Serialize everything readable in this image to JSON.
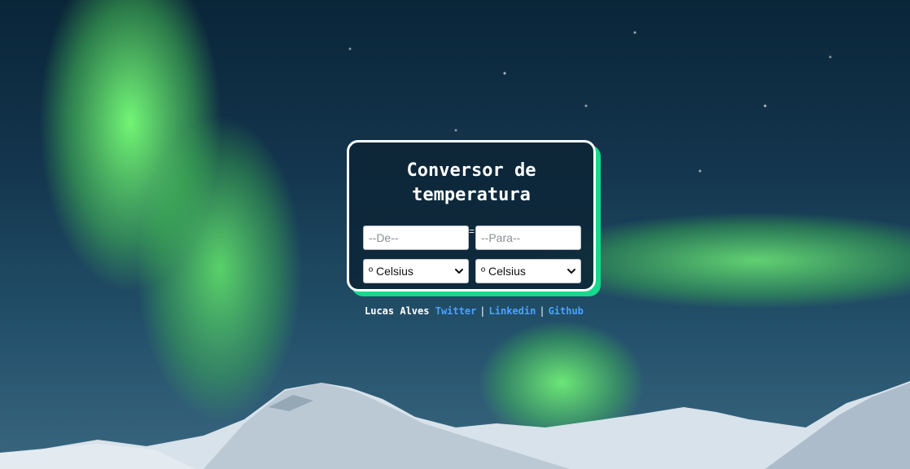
{
  "card": {
    "title_line1": "Conversor de",
    "title_line2": "temperatura",
    "from_placeholder": "--De--",
    "to_placeholder": "--Para--",
    "equals": "=",
    "from_unit": "º Celsius",
    "to_unit": "º Celsius"
  },
  "footer": {
    "author": "Lucas Alves",
    "links": [
      "Twitter",
      "Linkedin",
      "Github"
    ],
    "separator": "|"
  },
  "colors": {
    "card_shadow": "#17d98d",
    "link": "#4aa3ff"
  }
}
